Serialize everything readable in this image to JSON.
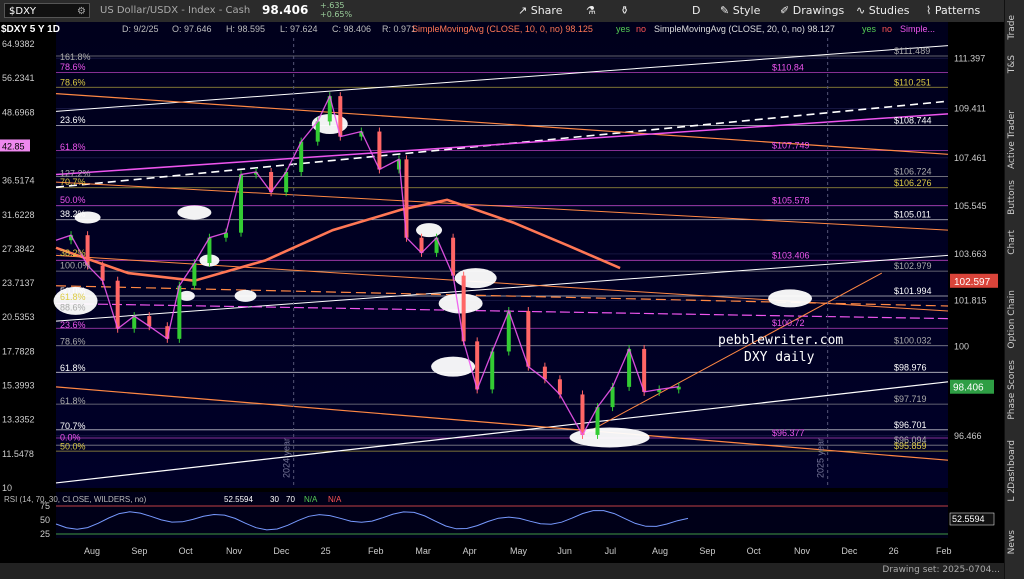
{
  "header": {
    "symbol": "$DXY",
    "description": "US Dollar/USDX - Index - Cash",
    "last_price": "98.406",
    "change": "+.635",
    "change_pct": "+0.65%",
    "buttons": {
      "share": "Share",
      "style": "Style",
      "drawings": "Drawings",
      "studies": "Studies",
      "patterns": "Patterns",
      "period": "D"
    }
  },
  "info_line": {
    "title": "$DXY 5 Y 1D",
    "date": "D: 9/2/25",
    "o": "O: 97.646",
    "h": "H: 98.595",
    "l": "L: 97.624",
    "c": "C: 98.406",
    "r": "R: 0.971",
    "sma10": "SimpleMovingAvg (CLOSE, 10, 0, no) 98.125",
    "sma20": "SimpleMovingAvg (CLOSE, 20, 0, no) 98.127",
    "yes": "yes",
    "no": "no",
    "more": "Simple..."
  },
  "sidebar_tabs": [
    "Trade",
    "T&S",
    "Active Trader",
    "Buttons",
    "Chart",
    "Option Chain",
    "Phase Scores",
    "Dashboard",
    "L 2",
    "News"
  ],
  "rsi_label": {
    "text": "RSI (14, 70, 30, CLOSE, WILDERS, no)",
    "value": "52.5594",
    "ob": "30",
    "os": "70",
    "na1": "N/A",
    "na2": "N/A"
  },
  "watermark": {
    "line1": "pebblewriter.com",
    "line2": "DXY daily"
  },
  "bottom_bar": {
    "drawing_set": "Drawing set: 2025-0704..."
  },
  "colors": {
    "background": "#000022",
    "price_line": "#cccccc",
    "up_candle": "#33cc33",
    "down_candle": "#ff6666",
    "sma_orange": "#ff7755",
    "fib_pink": "#ee55ee",
    "fib_yellow": "#ddcc44",
    "channel_white": "#ffffff",
    "trend_orange": "#ff8844",
    "last_price_badge": "#2e9e44",
    "red_badge": "#d9443a"
  },
  "chart_data": {
    "type": "line",
    "title": "$DXY 5 Y 1D",
    "x_ticks": [
      "Aug",
      "Sep",
      "Oct",
      "Nov",
      "Dec",
      "25",
      "Feb",
      "Mar",
      "Apr",
      "May",
      "Jun",
      "Jul",
      "Aug",
      "Sep",
      "Oct",
      "Nov",
      "Dec",
      "26",
      "Feb"
    ],
    "right_axis_ticks": [
      "111.397",
      "109.411",
      "107.461",
      "105.545",
      "103.663",
      "101.815",
      "100",
      "96.466"
    ],
    "left_axis_ticks": [
      "64.9382",
      "56.2341",
      "48.6968",
      "42.85",
      "36.5174",
      "31.6228",
      "27.3842",
      "23.7137",
      "20.5353",
      "17.7828",
      "15.3993",
      "13.3352",
      "11.5478",
      "10"
    ],
    "left_highlight_value": "42.85",
    "price_series": [
      {
        "date": "2024-07-15",
        "close": 104.2
      },
      {
        "date": "2024-07-25",
        "close": 104.4
      },
      {
        "date": "2024-08-05",
        "close": 103.2
      },
      {
        "date": "2024-08-15",
        "close": 102.6
      },
      {
        "date": "2024-08-25",
        "close": 100.7
      },
      {
        "date": "2024-09-05",
        "close": 101.2
      },
      {
        "date": "2024-09-15",
        "close": 100.8
      },
      {
        "date": "2024-09-27",
        "close": 100.3
      },
      {
        "date": "2024-10-05",
        "close": 102.4
      },
      {
        "date": "2024-10-15",
        "close": 103.3
      },
      {
        "date": "2024-10-25",
        "close": 104.3
      },
      {
        "date": "2024-11-05",
        "close": 104.5
      },
      {
        "date": "2024-11-15",
        "close": 106.8
      },
      {
        "date": "2024-11-25",
        "close": 106.9
      },
      {
        "date": "2024-12-05",
        "close": 106.1
      },
      {
        "date": "2024-12-15",
        "close": 106.9
      },
      {
        "date": "2024-12-25",
        "close": 108.1
      },
      {
        "date": "2025-01-05",
        "close": 108.9
      },
      {
        "date": "2025-01-13",
        "close": 109.9
      },
      {
        "date": "2025-01-20",
        "close": 108.3
      },
      {
        "date": "2025-02-03",
        "close": 108.5
      },
      {
        "date": "2025-02-15",
        "close": 107.0
      },
      {
        "date": "2025-02-28",
        "close": 107.4
      },
      {
        "date": "2025-03-05",
        "close": 104.3
      },
      {
        "date": "2025-03-15",
        "close": 103.7
      },
      {
        "date": "2025-03-25",
        "close": 104.3
      },
      {
        "date": "2025-04-05",
        "close": 102.8
      },
      {
        "date": "2025-04-12",
        "close": 100.2
      },
      {
        "date": "2025-04-21",
        "close": 98.3
      },
      {
        "date": "2025-05-01",
        "close": 99.8
      },
      {
        "date": "2025-05-12",
        "close": 101.4
      },
      {
        "date": "2025-05-25",
        "close": 99.2
      },
      {
        "date": "2025-06-05",
        "close": 98.7
      },
      {
        "date": "2025-06-15",
        "close": 98.1
      },
      {
        "date": "2025-06-30",
        "close": 96.5
      },
      {
        "date": "2025-07-10",
        "close": 97.6
      },
      {
        "date": "2025-07-20",
        "close": 98.4
      },
      {
        "date": "2025-07-31",
        "close": 99.9
      },
      {
        "date": "2025-08-10",
        "close": 98.2
      },
      {
        "date": "2025-08-20",
        "close": 98.3
      },
      {
        "date": "2025-09-02",
        "close": 98.406
      }
    ],
    "sma_series": [
      {
        "date": "2024-07-15",
        "value": 103.9
      },
      {
        "date": "2024-09-01",
        "value": 102.9
      },
      {
        "date": "2024-10-15",
        "value": 102.6
      },
      {
        "date": "2024-12-01",
        "value": 103.4
      },
      {
        "date": "2025-01-15",
        "value": 104.6
      },
      {
        "date": "2025-03-01",
        "value": 105.4
      },
      {
        "date": "2025-04-01",
        "value": 105.8
      },
      {
        "date": "2025-05-15",
        "value": 104.9
      },
      {
        "date": "2025-06-20",
        "value": 104.0
      },
      {
        "date": "2025-07-25",
        "value": 103.1
      }
    ],
    "right_labels": [
      {
        "value": 111.489,
        "text": "$111.489",
        "color": "#aaaaaa"
      },
      {
        "value": 110.84,
        "text": "$110.84",
        "color": "#ee55ee"
      },
      {
        "value": 110.251,
        "text": "$110.251",
        "color": "#ddcc44"
      },
      {
        "value": 108.744,
        "text": "$108.744",
        "color": "#ffffff"
      },
      {
        "value": 107.749,
        "text": "$107.749",
        "color": "#ee55ee"
      },
      {
        "value": 106.724,
        "text": "$106.724",
        "color": "#aaaaaa"
      },
      {
        "value": 106.276,
        "text": "$106.276",
        "color": "#ddcc44"
      },
      {
        "value": 105.578,
        "text": "$105.578",
        "color": "#ee55ee"
      },
      {
        "value": 105.011,
        "text": "$105.011",
        "color": "#ffffff"
      },
      {
        "value": 103.406,
        "text": "$103.406",
        "color": "#ee55ee"
      },
      {
        "value": 102.979,
        "text": "$102.979",
        "color": "#aaaaaa"
      },
      {
        "value": 101.994,
        "text": "$101.994",
        "color": "#ffffff"
      },
      {
        "value": 100.72,
        "text": "$100.72",
        "color": "#ee55ee"
      },
      {
        "value": 100.032,
        "text": "$100.032",
        "color": "#aaaaaa"
      },
      {
        "value": 98.976,
        "text": "$98.976",
        "color": "#ffffff"
      },
      {
        "value": 97.719,
        "text": "$97.719",
        "color": "#aaaaaa"
      },
      {
        "value": 96.701,
        "text": "$96.701",
        "color": "#ffffff"
      },
      {
        "value": 96.377,
        "text": "$96.377",
        "color": "#ee55ee"
      },
      {
        "value": 96.094,
        "text": "$96.094",
        "color": "#aaaaaa"
      },
      {
        "value": 95.859,
        "text": "$95.859",
        "color": "#ddcc44"
      }
    ],
    "fib_labels": [
      {
        "value": 111.25,
        "text": "161.8%",
        "color": "#aaaaaa"
      },
      {
        "value": 110.85,
        "text": "78.6%",
        "color": "#ee55ee"
      },
      {
        "value": 110.25,
        "text": "78.6%",
        "color": "#ddcc44"
      },
      {
        "value": 108.75,
        "text": "23.6%",
        "color": "#ffffff"
      },
      {
        "value": 107.7,
        "text": "61.8%",
        "color": "#ee55ee"
      },
      {
        "value": 106.65,
        "text": "127.2%",
        "color": "#aaaaaa"
      },
      {
        "value": 106.3,
        "text": "70.7%",
        "color": "#ddcc44"
      },
      {
        "value": 105.6,
        "text": "50.0%",
        "color": "#ee55ee"
      },
      {
        "value": 105.05,
        "text": "38.2%",
        "color": "#ffffff"
      },
      {
        "value": 103.5,
        "text": "38.2%",
        "color": "#ddcc44"
      },
      {
        "value": 103.0,
        "text": "100.0%",
        "color": "#aaaaaa"
      },
      {
        "value": 102.0,
        "text": "50.0%",
        "color": "#ffffff"
      },
      {
        "value": 101.75,
        "text": "61.8%",
        "color": "#ddcc44"
      },
      {
        "value": 101.35,
        "text": "88.6%",
        "color": "#aaaaaa"
      },
      {
        "value": 100.65,
        "text": "23.6%",
        "color": "#ee55ee"
      },
      {
        "value": 100.0,
        "text": "78.6%",
        "color": "#aaaaaa"
      },
      {
        "value": 98.95,
        "text": "61.8%",
        "color": "#ffffff"
      },
      {
        "value": 97.65,
        "text": "61.8%",
        "color": "#aaaaaa"
      },
      {
        "value": 96.65,
        "text": "70.7%",
        "color": "#ffffff"
      },
      {
        "value": 96.2,
        "text": "0.0%",
        "color": "#ee55ee"
      },
      {
        "value": 95.85,
        "text": "50.0%",
        "color": "#ddcc44"
      }
    ],
    "red_badge_value": "102.597",
    "last_badge_value": "98.406",
    "rsi_axis_ticks": [
      "75",
      "50",
      "25"
    ],
    "year_labels": [
      "2024 year",
      "2025 year"
    ]
  }
}
